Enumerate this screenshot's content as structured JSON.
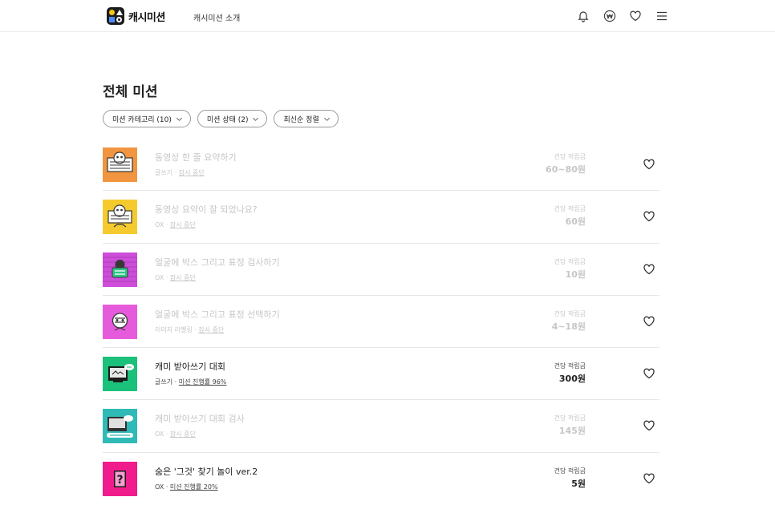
{
  "header": {
    "logo_text": "캐시미션",
    "nav_intro": "캐시미션 소개",
    "icons": [
      "bell-icon",
      "won-icon",
      "heart-icon",
      "menu-icon"
    ]
  },
  "page": {
    "title": "전체 미션"
  },
  "filters": [
    {
      "label": "미션 카테고리 (10)"
    },
    {
      "label": "미션 상태 (2)"
    },
    {
      "label": "최신순 정렬"
    }
  ],
  "reward_label": "건당 적립금",
  "colors": {
    "ended_text": "#c6c6c6",
    "thumb_orange": "#f08a2c",
    "thumb_yellow": "#f5c518",
    "thumb_purple": "#c93ad6",
    "thumb_magenta": "#e44ad8",
    "thumb_green": "#1bc07a",
    "thumb_teal": "#1ab3b0",
    "thumb_pink": "#f01c8c"
  },
  "missions": [
    {
      "title": "동영상 한 줄 요약하기",
      "category": "글쓰기",
      "separator": "·",
      "status": "잠시 중단",
      "reward": "60~80원",
      "ended": true,
      "thumb": "orange"
    },
    {
      "title": "동영상 요약이 잘 되었나요?",
      "category": "OX",
      "separator": "·",
      "status": "잠시 중단",
      "reward": "60원",
      "ended": true,
      "thumb": "yellow"
    },
    {
      "title": "얼굴에 박스 그리고 표정 검사하기",
      "category": "OX",
      "separator": "·",
      "status": "잠시 중단",
      "reward": "10원",
      "ended": true,
      "thumb": "purple"
    },
    {
      "title": "얼굴에 박스 그리고 표정 선택하기",
      "category": "이미지 라벨링",
      "separator": "·",
      "status": "잠시 중단",
      "reward": "4~18원",
      "ended": true,
      "thumb": "magenta"
    },
    {
      "title": "캐미 받아쓰기 대회",
      "category": "글쓰기",
      "separator": "·",
      "status": "미션 진행률 96%",
      "reward": "300원",
      "ended": false,
      "thumb": "green"
    },
    {
      "title": "캐미 받아쓰기 대회 검사",
      "category": "OX",
      "separator": "·",
      "status": "잠시 중단",
      "reward": "145원",
      "ended": true,
      "thumb": "teal"
    },
    {
      "title": "숨은 '그것' 찾기 놀이 ver.2",
      "category": "OX",
      "separator": "·",
      "status": "미션 진행률 20%",
      "reward": "5원",
      "ended": false,
      "thumb": "pink"
    }
  ]
}
